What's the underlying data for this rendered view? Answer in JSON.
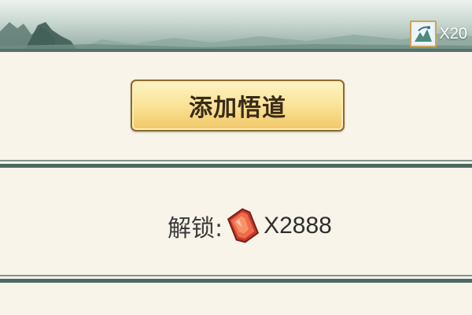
{
  "header": {
    "currency": {
      "icon": "painting-scroll-icon",
      "count": "X20"
    }
  },
  "main": {
    "add_button_label": "添加悟道",
    "unlock": {
      "label": "解锁:",
      "cost_icon": "red-gem-icon",
      "cost": "X2888"
    }
  },
  "colors": {
    "background": "#f8f4ea",
    "divider": "#4d6862",
    "button_fill": "#f9e397",
    "button_border": "#8e6a2e",
    "gem": "#e0523a"
  }
}
